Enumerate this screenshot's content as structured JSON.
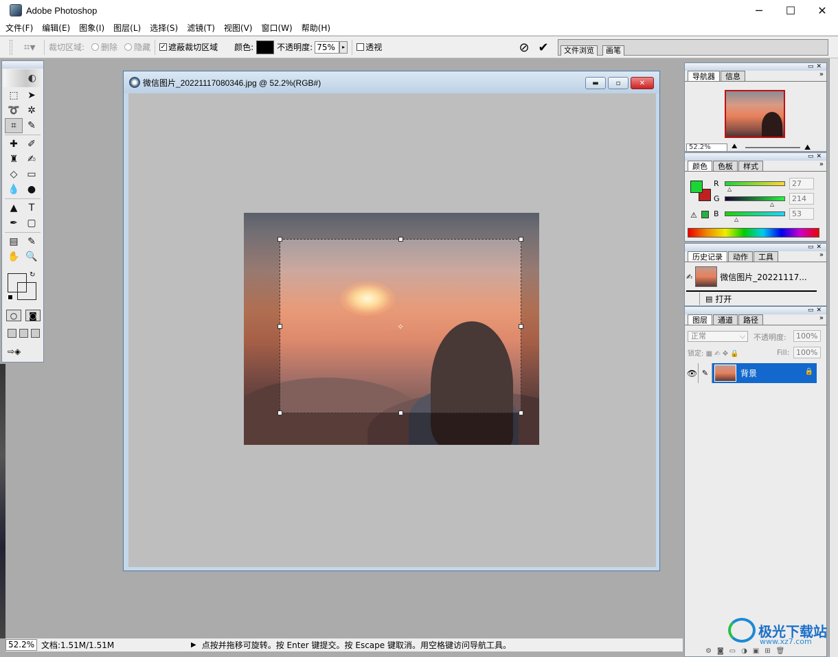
{
  "app": {
    "title": "Adobe Photoshop",
    "controls": {
      "minimize": "─",
      "maximize": "☐",
      "close": "✕"
    }
  },
  "menu": [
    "文件(F)",
    "编辑(E)",
    "图象(I)",
    "图层(L)",
    "选择(S)",
    "滤镜(T)",
    "视图(V)",
    "窗口(W)",
    "帮助(H)"
  ],
  "options": {
    "crop_area_label": "裁切区域:",
    "delete_label": "删除",
    "hide_label": "隐藏",
    "shield_label": "遮蔽裁切区域",
    "shield_checked": true,
    "color_label": "颜色:",
    "shield_color": "#000000",
    "opacity_label": "不透明度:",
    "opacity_value": "75%",
    "perspective_label": "透视",
    "perspective_checked": false,
    "well_tabs": [
      "文件浏览",
      "画笔"
    ]
  },
  "toolbox": {
    "fg_color": "#1bd635",
    "bg_color": "#c02020"
  },
  "document": {
    "title": "微信图片_20221117080346.jpg @ 52.2%(RGB#)",
    "buttons": {
      "minimize": "▬",
      "restore": "▫",
      "close": "✕"
    }
  },
  "navigator": {
    "tabs": [
      "导航器",
      "信息"
    ],
    "zoom": "52.2%"
  },
  "color": {
    "tabs": [
      "颜色",
      "色板",
      "样式"
    ],
    "r_label": "R",
    "r_value": "27",
    "g_label": "G",
    "g_value": "214",
    "b_label": "B",
    "b_value": "53"
  },
  "history": {
    "tabs": [
      "历史记录",
      "动作",
      "工具"
    ],
    "snapshot": "微信图片_20221117...",
    "step": "打开"
  },
  "layers": {
    "tabs": [
      "图层",
      "通道",
      "路径"
    ],
    "blend_mode": "正常",
    "opacity_label": "不透明度:",
    "opacity_value": "100%",
    "lock_label": "锁定:",
    "fill_label": "Fill:",
    "fill_value": "100%",
    "layer_name": "背景"
  },
  "status": {
    "zoom": "52.2%",
    "doc_size": "文档:1.51M/1.51M",
    "message": "点按并拖移可旋转。按 Enter 键提交。按 Escape 键取消。用空格键访问导航工具。"
  },
  "watermark": {
    "text": "极光下载站",
    "url": "www.xz7.com"
  }
}
